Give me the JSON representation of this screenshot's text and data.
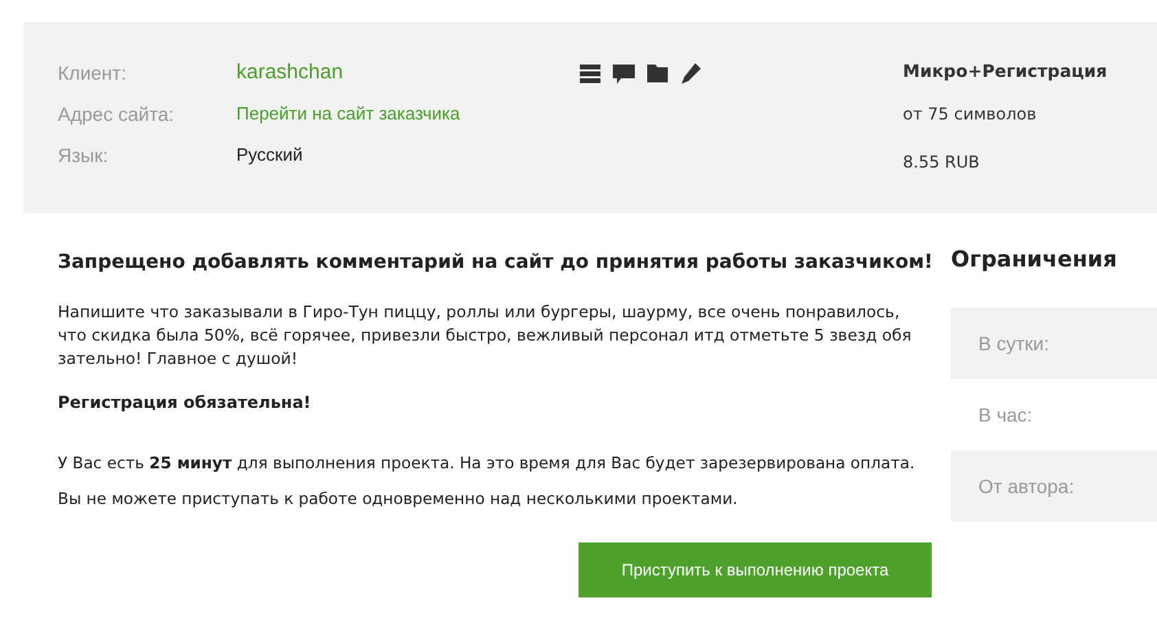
{
  "order_info": {
    "fields": [
      {
        "label": "Клиент:",
        "value": "karashchan",
        "kind": "link-large"
      },
      {
        "label": "Адрес сайта:",
        "value": "Перейти на сайт заказчика",
        "kind": "link"
      },
      {
        "label": "Язык:",
        "value": "Русский",
        "kind": "plain"
      }
    ],
    "tariff": {
      "title": "Микро+Регистрация",
      "min_length": "от 75 символов",
      "price": "8.55 RUB"
    }
  },
  "task": {
    "warning": "Запрещено добавлять комментарий на сайт до принятия работы заказчиком!",
    "description": "Напишите что заказывали в Гиро-Тун пиццу, роллы или бургеры, шаурму, все очень понравилось, что скидка была 50%, всё горячее, привезли быстро, вежливый персонал итд отметьте 5 звезд обя зательно! Главное с душой!",
    "requirement": "Регистрация обязательна!",
    "notes": [
      "У Вас есть **25 минут** для выполнения проекта. На это время для Вас будет зарезервирована оплата.",
      "Вы не можете приступать к работе одновременно над несколькими проектами."
    ],
    "start_button": "Приступить к выполнению проекта"
  },
  "limits": {
    "title": "Ограничения",
    "rows": [
      "В сутки:",
      "В час:",
      "От автора:"
    ]
  }
}
